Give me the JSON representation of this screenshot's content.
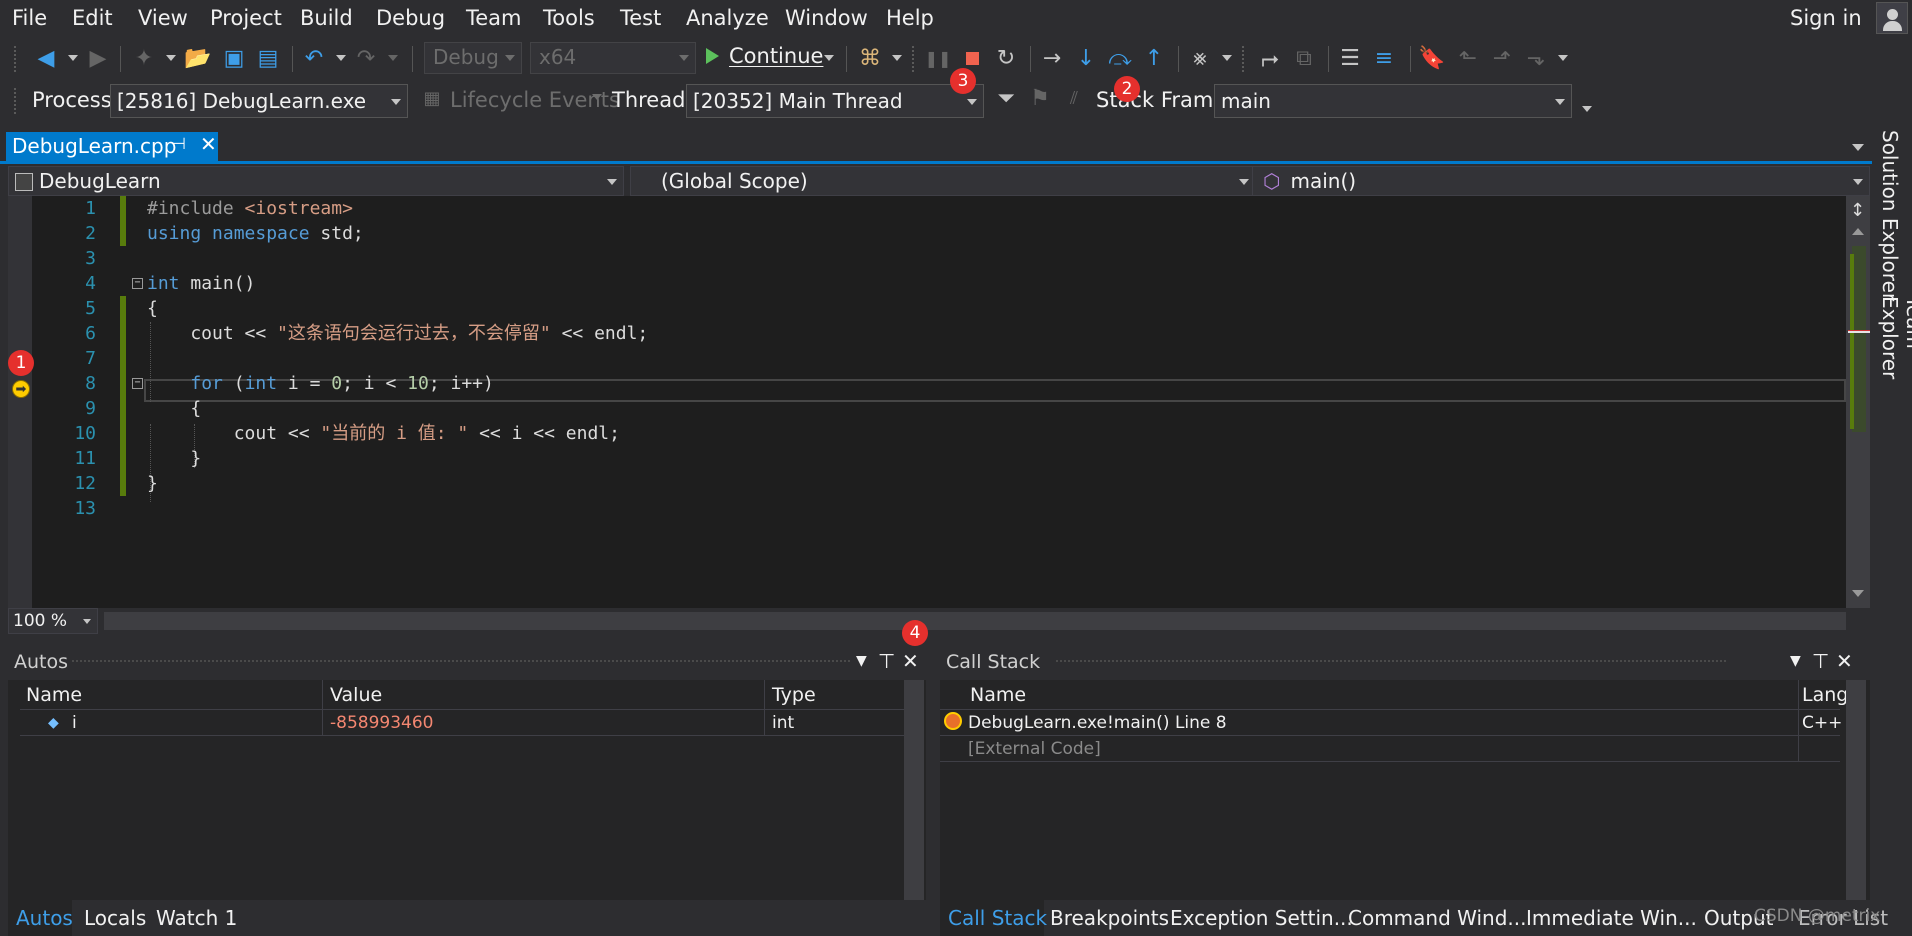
{
  "menu": {
    "items": [
      "File",
      "Edit",
      "View",
      "Project",
      "Build",
      "Debug",
      "Team",
      "Tools",
      "Test",
      "Analyze",
      "Window",
      "Help"
    ],
    "sign_in": "Sign in"
  },
  "toolbar": {
    "config": "Debug",
    "platform": "x64",
    "continue_label": "Continue"
  },
  "debug_location": {
    "process_label": "Process:",
    "process_value": "[25816] DebugLearn.exe",
    "lifecycle_label": "Lifecycle Events",
    "thread_label": "Thread:",
    "thread_value": "[20352] Main Thread",
    "stack_frame_label": "Stack Frame:",
    "stack_frame_value": "main"
  },
  "badges": [
    "1",
    "2",
    "3",
    "4"
  ],
  "document_tab": {
    "filename": "DebugLearn.cpp"
  },
  "navbar": {
    "project": "DebugLearn",
    "scope": "(Global Scope)",
    "member": "main()"
  },
  "editor": {
    "line_numbers": [
      "1",
      "2",
      "3",
      "4",
      "5",
      "6",
      "7",
      "8",
      "9",
      "10",
      "11",
      "12",
      "13"
    ],
    "current_line": "8",
    "zoom": "100 %"
  },
  "side_tabs": [
    "Solution Explorer",
    "Team Explorer"
  ],
  "autos": {
    "title": "Autos",
    "columns": [
      "Name",
      "Value",
      "Type"
    ],
    "rows": [
      {
        "name": "i",
        "value": "-858993460",
        "type": "int"
      }
    ],
    "value_color": "#f48771"
  },
  "call_stack": {
    "title": "Call Stack",
    "columns": [
      "Name",
      "Lang"
    ],
    "rows": [
      {
        "name": "DebugLearn.exe!main() Line 8",
        "lang": "C++"
      },
      {
        "name": "[External Code]",
        "lang": ""
      }
    ]
  },
  "bottom_tabs_left": [
    "Autos",
    "Locals",
    "Watch 1"
  ],
  "bottom_tabs_right": [
    "Call Stack",
    "Breakpoints",
    "Exception Settin...",
    "Command Wind...",
    "Immediate Win...",
    "Output"
  ],
  "overlap_label": "Error List",
  "watermark": "CSDN @metrix",
  "colors": {
    "accent": "#007acc",
    "badge": "#e5302d",
    "change_bar": "#587c0c",
    "line_number": "#2b91af",
    "keyword": "#569cd6",
    "string": "#d69d85"
  }
}
